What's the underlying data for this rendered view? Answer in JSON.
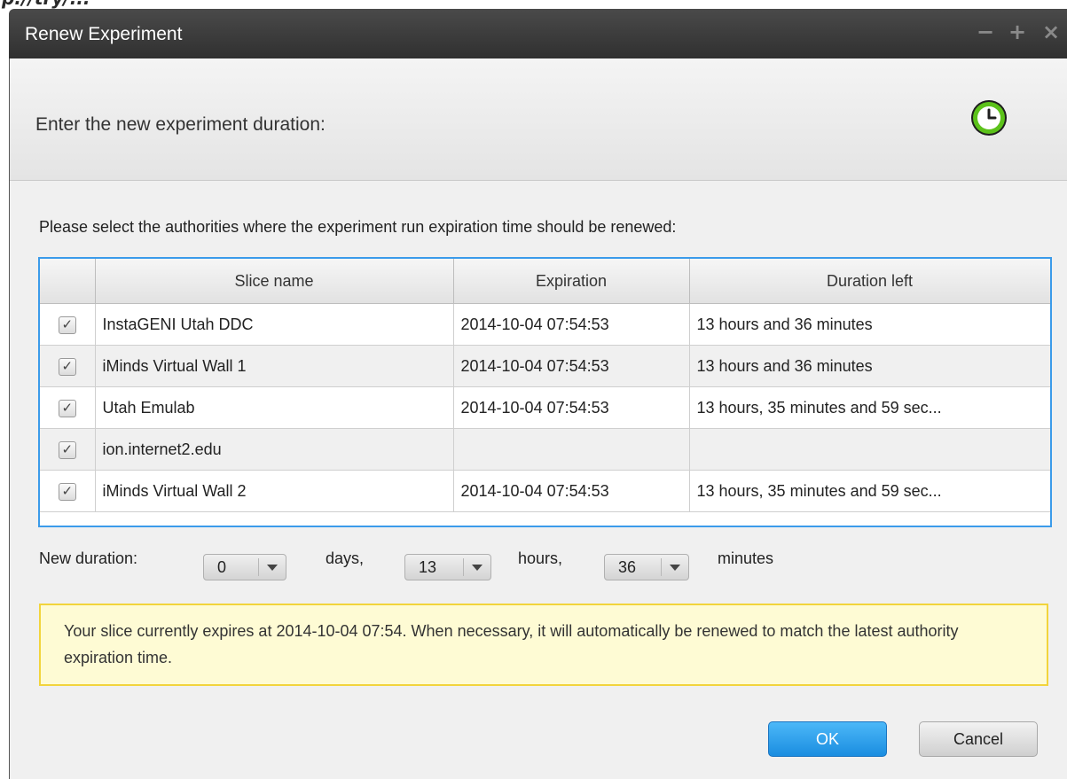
{
  "top_fragment": "p://try/...",
  "window": {
    "title": "Renew Experiment",
    "controls": {
      "minimize": "−",
      "maximize": "+",
      "close": "×"
    }
  },
  "header": {
    "text": "Enter the new experiment duration:",
    "icon": "clock-icon"
  },
  "instructions": "Please select the authorities where the experiment run expiration time should be renewed:",
  "table": {
    "columns": [
      "",
      "Slice name",
      "Expiration",
      "Duration left"
    ],
    "rows": [
      {
        "checked": true,
        "slice": "InstaGENI Utah DDC",
        "expiration": "2014-10-04 07:54:53",
        "duration": "13 hours and 36 minutes"
      },
      {
        "checked": true,
        "slice": "iMinds Virtual Wall 1",
        "expiration": "2014-10-04 07:54:53",
        "duration": "13 hours and 36 minutes"
      },
      {
        "checked": true,
        "slice": "Utah Emulab",
        "expiration": "2014-10-04 07:54:53",
        "duration": "13 hours, 35 minutes and 59 sec..."
      },
      {
        "checked": true,
        "slice": "ion.internet2.edu",
        "expiration": "",
        "duration": ""
      },
      {
        "checked": true,
        "slice": "iMinds Virtual Wall 2",
        "expiration": "2014-10-04 07:54:53",
        "duration": "13 hours, 35 minutes and 59 sec..."
      }
    ]
  },
  "duration": {
    "label": "New duration:",
    "days_value": "0",
    "days_label": "days,",
    "hours_value": "13",
    "hours_label": "hours,",
    "minutes_value": "36",
    "minutes_label": "minutes"
  },
  "notice": "Your slice currently expires at 2014-10-04 07:54. When necessary, it will automatically be renewed to match the latest authority expiration time.",
  "buttons": {
    "ok": "OK",
    "cancel": "Cancel"
  },
  "colors": {
    "accent": "#1a8de0",
    "notice_bg": "#fefbd4",
    "notice_border": "#f2d43c",
    "clock_green": "#5cc21a"
  }
}
